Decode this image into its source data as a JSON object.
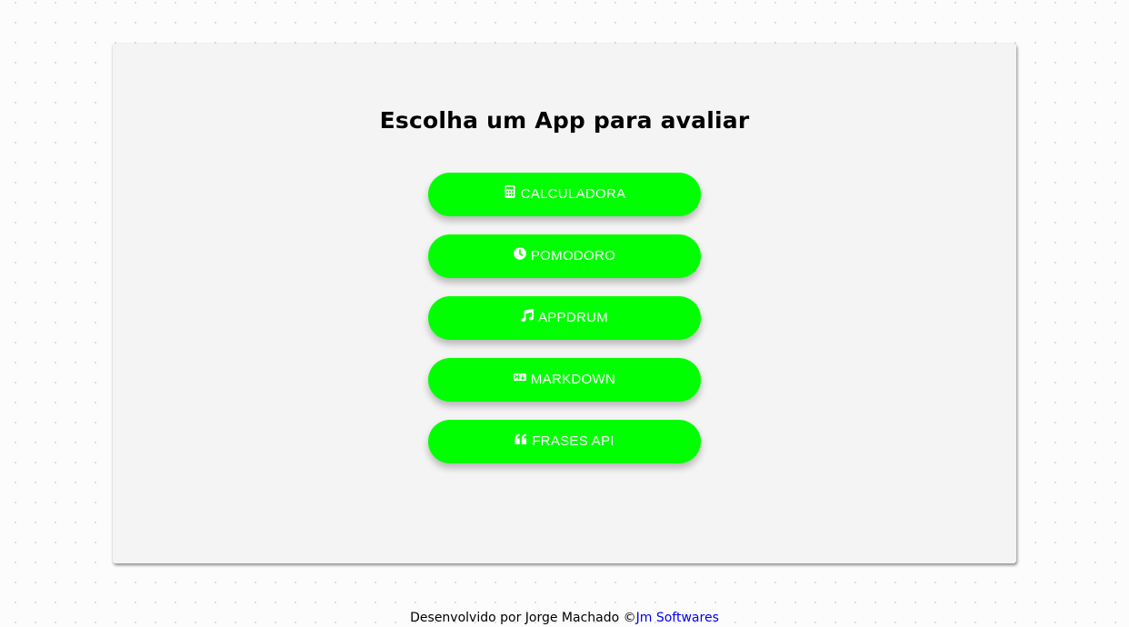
{
  "page": {
    "title": "Escolha um App para avaliar"
  },
  "apps": [
    {
      "label": "CALCULADORA",
      "icon": "calculator-icon"
    },
    {
      "label": "POMODORO",
      "icon": "clock-icon"
    },
    {
      "label": "APPDRUM",
      "icon": "music-note-icon"
    },
    {
      "label": "MARKDOWN",
      "icon": "markdown-icon"
    },
    {
      "label": "FRASES API",
      "icon": "quote-icon"
    }
  ],
  "footer": {
    "text": "Desenvolvido por Jorge Machado ©",
    "link_label": "Jm Softwares"
  },
  "colors": {
    "button_bg": "#00ff00",
    "button_text": "#ffffff",
    "card_bg": "#f4f4f4",
    "link": "#0000ee"
  }
}
